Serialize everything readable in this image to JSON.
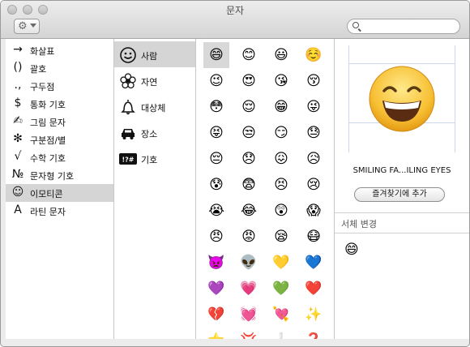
{
  "window": {
    "title": "문자"
  },
  "search": {
    "placeholder": ""
  },
  "categories": [
    {
      "icon": "→",
      "label": "화살표"
    },
    {
      "icon": "()",
      "label": "괄호"
    },
    {
      "icon": ".,",
      "label": "구두점"
    },
    {
      "icon": "$",
      "label": "통화 기호"
    },
    {
      "icon": "✍",
      "label": "그림 문자"
    },
    {
      "icon": "✻",
      "label": "구분점/별"
    },
    {
      "icon": "√",
      "label": "수학 기호"
    },
    {
      "icon": "№",
      "label": "문자형 기호"
    },
    {
      "icon": "☺",
      "label": "이모티콘",
      "selected": true
    },
    {
      "icon": "A",
      "label": "라틴 문자"
    }
  ],
  "subcategories": [
    {
      "icon": "smiley-face-icon",
      "label": "사람",
      "selected": true
    },
    {
      "icon": "flower-icon",
      "label": "자연"
    },
    {
      "icon": "bell-icon",
      "label": "대상체"
    },
    {
      "icon": "car-icon",
      "label": "장소"
    },
    {
      "icon": "symbols-icon",
      "label": "기호",
      "badge": "!?#"
    }
  ],
  "emoji_grid": [
    [
      "😄",
      "😊",
      "😃",
      "☺️"
    ],
    [
      "😉",
      "😍",
      "😘",
      "😚"
    ],
    [
      "😳",
      "😌",
      "😁",
      "😜"
    ],
    [
      "😝",
      "😒",
      "😏",
      "😓"
    ],
    [
      "😔",
      "😞",
      "😖",
      "😥"
    ],
    [
      "😰",
      "😨",
      "😣",
      "😢"
    ],
    [
      "😭",
      "😂",
      "😲",
      "😱"
    ],
    [
      "😠",
      "😡",
      "😪",
      "😷"
    ],
    [
      "👿",
      "👽",
      "💛",
      "💙"
    ],
    [
      "💜",
      "💗",
      "💚",
      "❤️"
    ],
    [
      "💔",
      "💓",
      "💘",
      "✨"
    ],
    [
      "⭐",
      "💢",
      "❕",
      "❓"
    ]
  ],
  "selected_char": {
    "emoji": "😄",
    "name": "SMILING FA...ILING EYES"
  },
  "favorites_button": "즐겨찾기에 추가",
  "font_variation": {
    "header": "서체 변경",
    "variants": [
      "😄"
    ]
  }
}
